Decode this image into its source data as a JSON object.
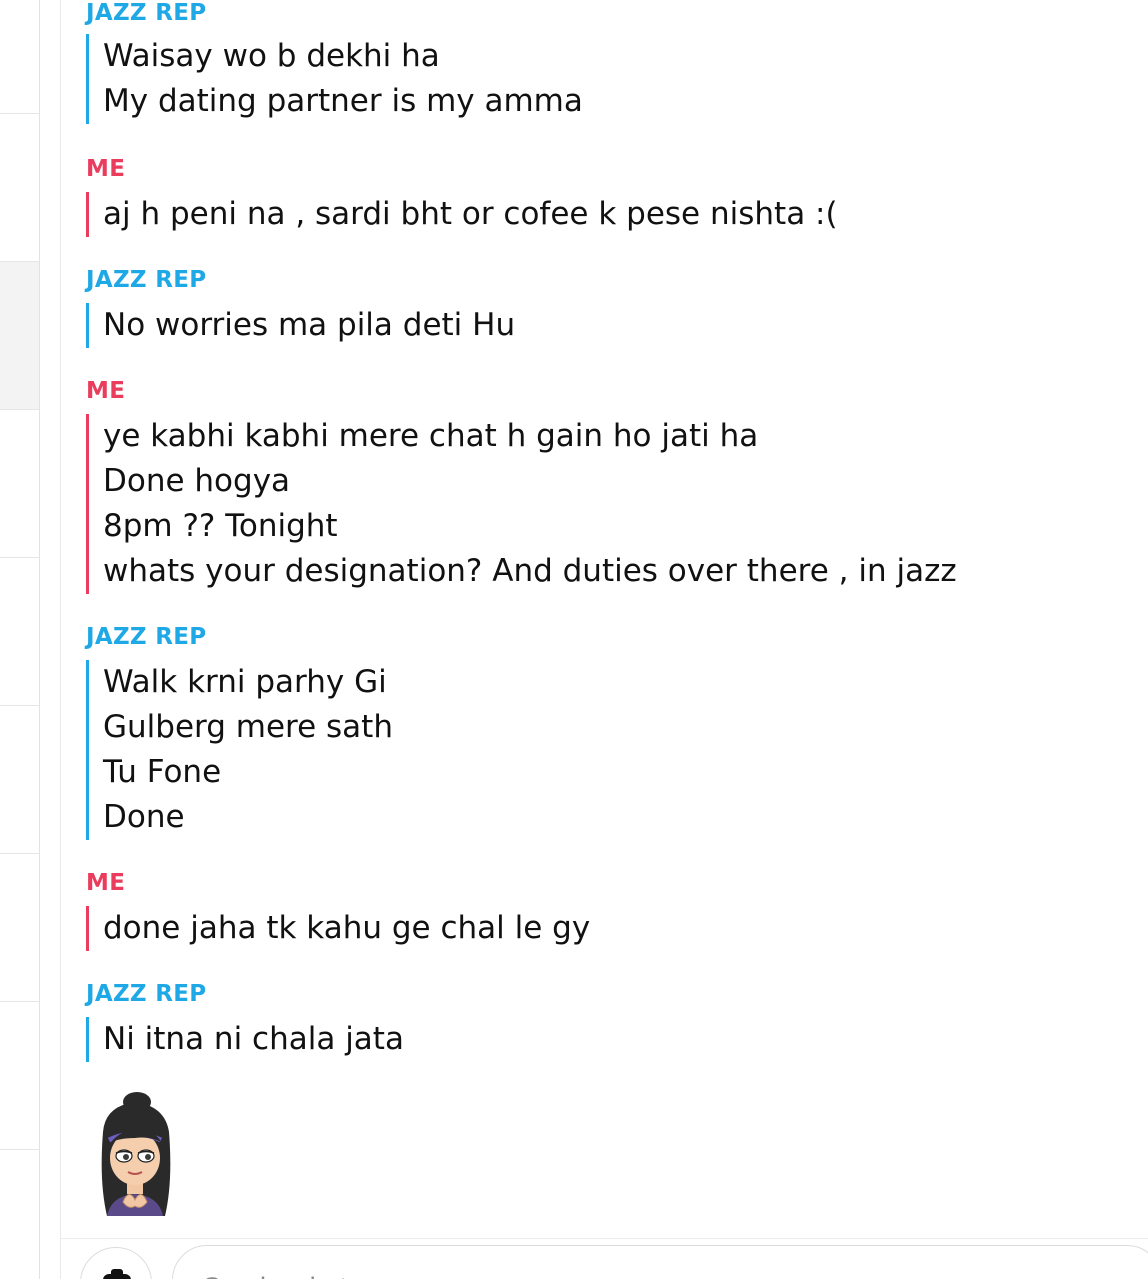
{
  "conversation": {
    "messages": [
      {
        "sender": "JAZZ REP",
        "lines": [
          "Waisay wo b dekhi ha",
          "My dating partner is my amma"
        ]
      },
      {
        "sender": "ME",
        "lines": [
          "aj h peni na , sardi bht or cofee k pese nishta :("
        ]
      },
      {
        "sender": "JAZZ REP",
        "lines": [
          "No worries ma pila deti Hu"
        ]
      },
      {
        "sender": "ME",
        "lines": [
          "ye kabhi kabhi mere chat h gain ho jati ha",
          "Done hogya",
          "8pm ?? Tonight",
          "whats your designation? And duties over there , in jazz"
        ]
      },
      {
        "sender": "JAZZ REP",
        "lines": [
          "Walk krni parhy Gi",
          "Gulberg mere sath",
          "Tu Fone",
          "Done"
        ]
      },
      {
        "sender": "ME",
        "lines": [
          "done jaha tk kahu ge chal le gy"
        ]
      },
      {
        "sender": "JAZZ REP",
        "lines": [
          "Ni itna ni chala jata"
        ]
      }
    ]
  },
  "avatar": {
    "icon": "bitmoji-avatar"
  },
  "composer": {
    "placeholder": "Send a chat",
    "camera_icon": "camera-icon"
  },
  "colors": {
    "friend_accent": "#1ea8e6",
    "me_accent": "#ea3d5e"
  }
}
